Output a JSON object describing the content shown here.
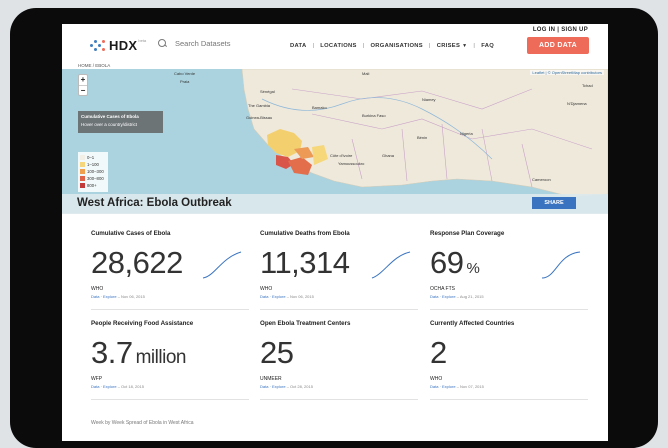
{
  "header": {
    "top_links": "LOG IN  |  SIGN UP",
    "logo_text": "HDX",
    "logo_beta": "beta",
    "search_placeholder": "Search Datasets",
    "nav": [
      {
        "label": "DATA"
      },
      {
        "label": "LOCATIONS"
      },
      {
        "label": "ORGANISATIONS"
      },
      {
        "label": "CRISES"
      },
      {
        "label": "FAQ"
      }
    ],
    "add_data_label": "ADD DATA"
  },
  "breadcrumb": "HOME / EBOLA",
  "map": {
    "attribution": "Leaflet | © OpenStreetMap contributors",
    "zoom_in": "+",
    "zoom_out": "−",
    "info_title": "Cumulative Cases of Ebola",
    "info_subtitle": "Hover over a country/district",
    "legend": [
      {
        "label": "0–1",
        "color": "#f2f0e6"
      },
      {
        "label": "1–100",
        "color": "#f6d67c"
      },
      {
        "label": "100–300",
        "color": "#efa14f"
      },
      {
        "label": "300–800",
        "color": "#e0644a"
      },
      {
        "label": "800+",
        "color": "#c23a3a"
      }
    ],
    "place_labels": [
      "Cabo Verde",
      "Praia",
      "Mali",
      "Niamey",
      "Bamako",
      "Sénégal",
      "The Gambia",
      "Guinea-Bissau",
      "Burkina Faso",
      "Bénin",
      "Nigeria",
      "Côte d'Ivoire",
      "Ghana",
      "Yamoussoukro",
      "Cameroon",
      "Tchad",
      "N'Djamena"
    ],
    "page_title": "West Africa: Ebola Outbreak",
    "share_label": "SHARE"
  },
  "stats": [
    {
      "title": "Cumulative Cases of Ebola",
      "value": "28,622",
      "unit": "",
      "source": "WHO",
      "links": "Data · Explore",
      "date": "Nov 06, 2015",
      "sparkline": true
    },
    {
      "title": "Cumulative Deaths from Ebola",
      "value": "11,314",
      "unit": "",
      "source": "WHO",
      "links": "Data · Explore",
      "date": "Nov 06, 2015",
      "sparkline": true
    },
    {
      "title": "Response Plan Coverage",
      "value": "69",
      "unit": "%",
      "source": "OCHA FTS",
      "links": "Data · Explore",
      "date": "Aug 21, 2015",
      "sparkline": true
    },
    {
      "title": "People Receiving Food Assistance",
      "value": "3.7",
      "unit": "million",
      "source": "WFP",
      "links": "Data · Explore",
      "date": "Oct 18, 2015",
      "sparkline": false
    },
    {
      "title": "Open Ebola Treatment Centers",
      "value": "25",
      "unit": "",
      "source": "UNMEER",
      "links": "Data · Explore",
      "date": "Oct 28, 2015",
      "sparkline": false
    },
    {
      "title": "Currently Affected Countries",
      "value": "2",
      "unit": "",
      "source": "WHO",
      "links": "Data · Explore",
      "date": "Nov 07, 2015",
      "sparkline": false
    }
  ],
  "bottom_note": "Week by Week Spread of Ebola in West Africa",
  "colors": {
    "accent": "#ee6b5a",
    "link": "#3a74c1",
    "sparkline": "#3a74c1"
  }
}
